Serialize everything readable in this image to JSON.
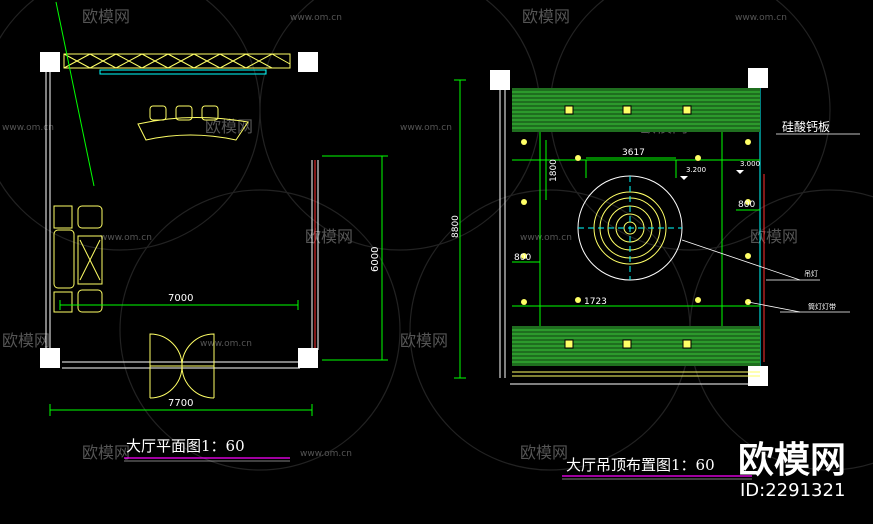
{
  "watermark": {
    "brand": "欧模网",
    "site": "www.om.cn",
    "id_text": "ID:2291321"
  },
  "plan_left": {
    "title": "大厅平面图1：60",
    "dims": {
      "inner_width": "7000",
      "outer_width": "7700",
      "depth": "6000"
    }
  },
  "plan_right": {
    "title": "大厅吊顶布置图1：60",
    "dims": {
      "overall_height": "8800",
      "ring_width": "3617",
      "left_offset": "1800",
      "side_offset": "800",
      "right_offset": "800",
      "light_spacing": "1723",
      "elev_a": "3.200",
      "elev_b": "3.000"
    },
    "labels": {
      "material": "硅酸钙板",
      "chandelier": "吊灯",
      "downlight": "筒灯灯带"
    }
  },
  "colors": {
    "background": "#000000",
    "wall": "#ffffff",
    "dim_line": "#00ff00",
    "furniture": "#ffff66",
    "ceiling_green": "#2e8b2e",
    "cyan": "#00ffff",
    "magenta": "#ff00ff",
    "red": "#ff3030"
  }
}
